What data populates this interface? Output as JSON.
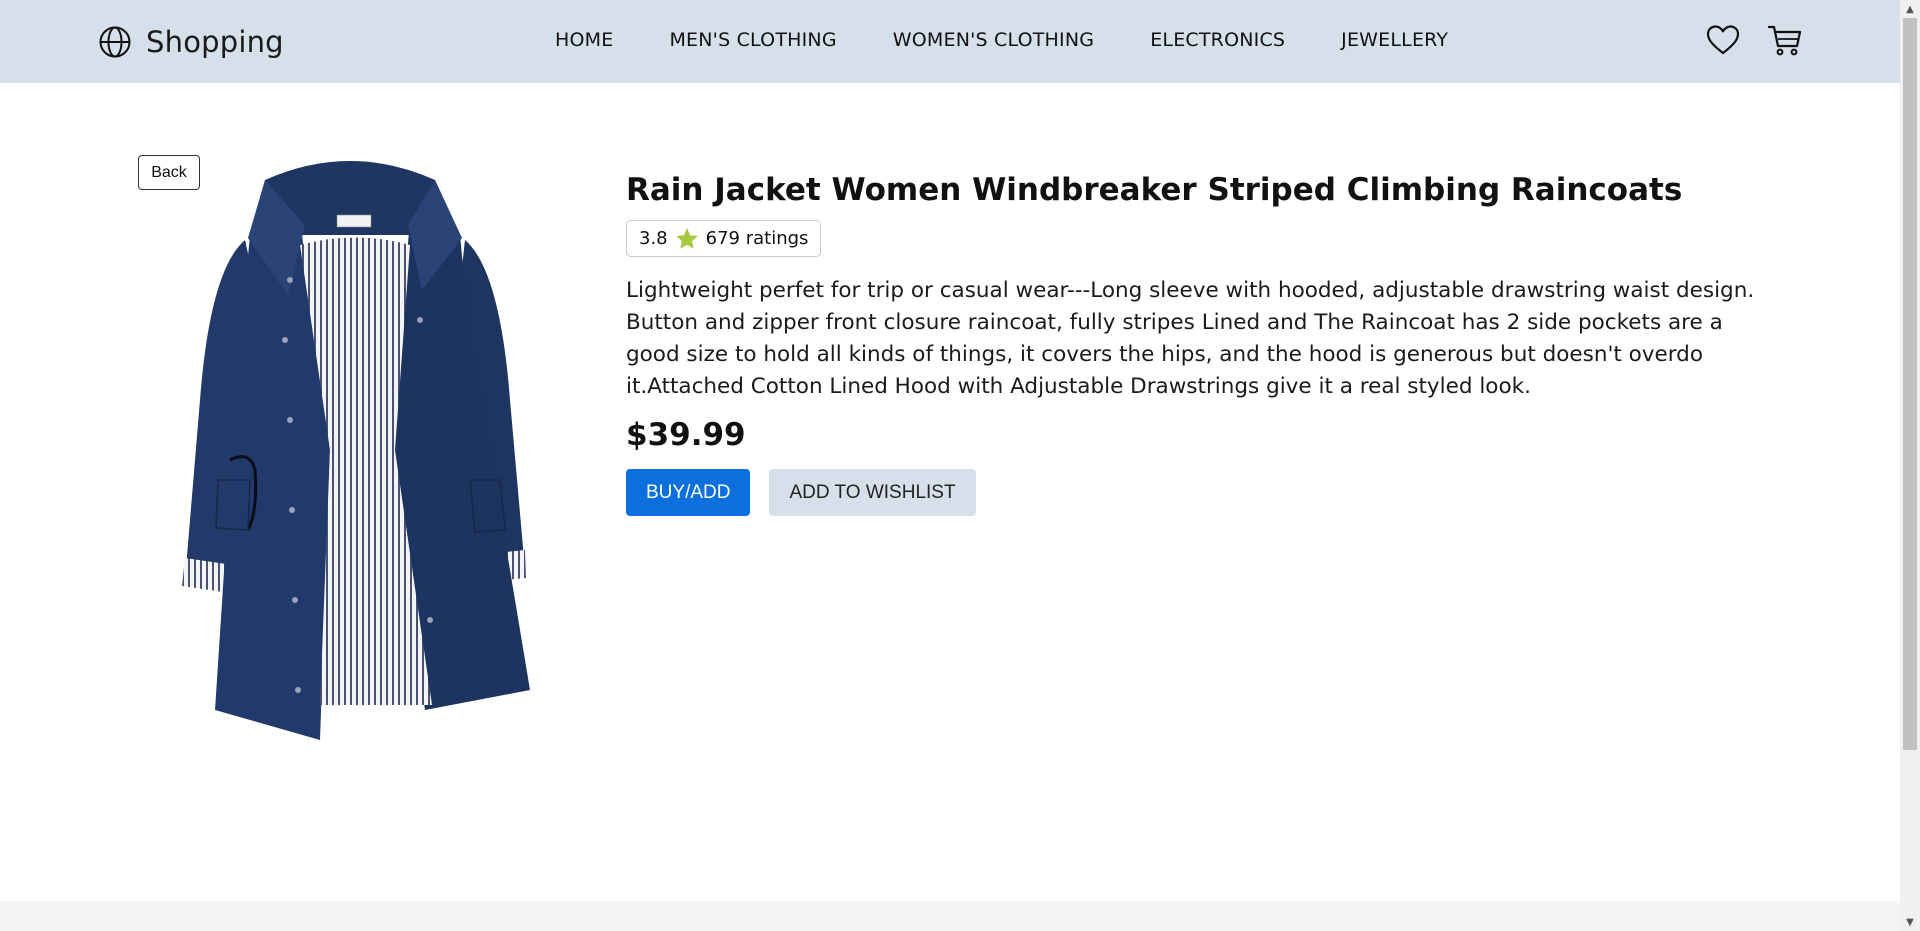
{
  "navbar": {
    "brand": {
      "label": "Shopping",
      "icon": "globe-icon"
    },
    "links": [
      {
        "label": "HOME"
      },
      {
        "label": "MEN'S CLOTHING"
      },
      {
        "label": "WOMEN'S CLOTHING"
      },
      {
        "label": "ELECTRONICS"
      },
      {
        "label": "JEWELLERY"
      }
    ],
    "icons": {
      "wishlist": "heart-icon",
      "cart": "cart-icon"
    },
    "background": "#d6e0ea"
  },
  "back_button": {
    "label": "Back"
  },
  "product": {
    "image": "navy rain jacket with striped lining",
    "title": "Rain Jacket Women Windbreaker Striped Climbing Raincoats",
    "rating": {
      "value": "3.8",
      "count_label": "679 ratings",
      "star_color": "#a8c93b"
    },
    "description": "Lightweight perfet for trip or casual wear---Long sleeve with hooded, adjustable drawstring waist design. Button and zipper front closure raincoat, fully stripes Lined and The Raincoat has 2 side pockets are a good size to hold all kinds of things, it covers the hips, and the hood is generous but doesn't overdo it.Attached Cotton Lined Hood with Adjustable Drawstrings give it a real styled look.",
    "price": "$39.99"
  },
  "actions": {
    "buy_label": "BUY/ADD",
    "wishlist_label": "ADD TO WISHLIST",
    "buy_color": "#0b6fde",
    "wishlist_color": "#d6e0ea"
  }
}
